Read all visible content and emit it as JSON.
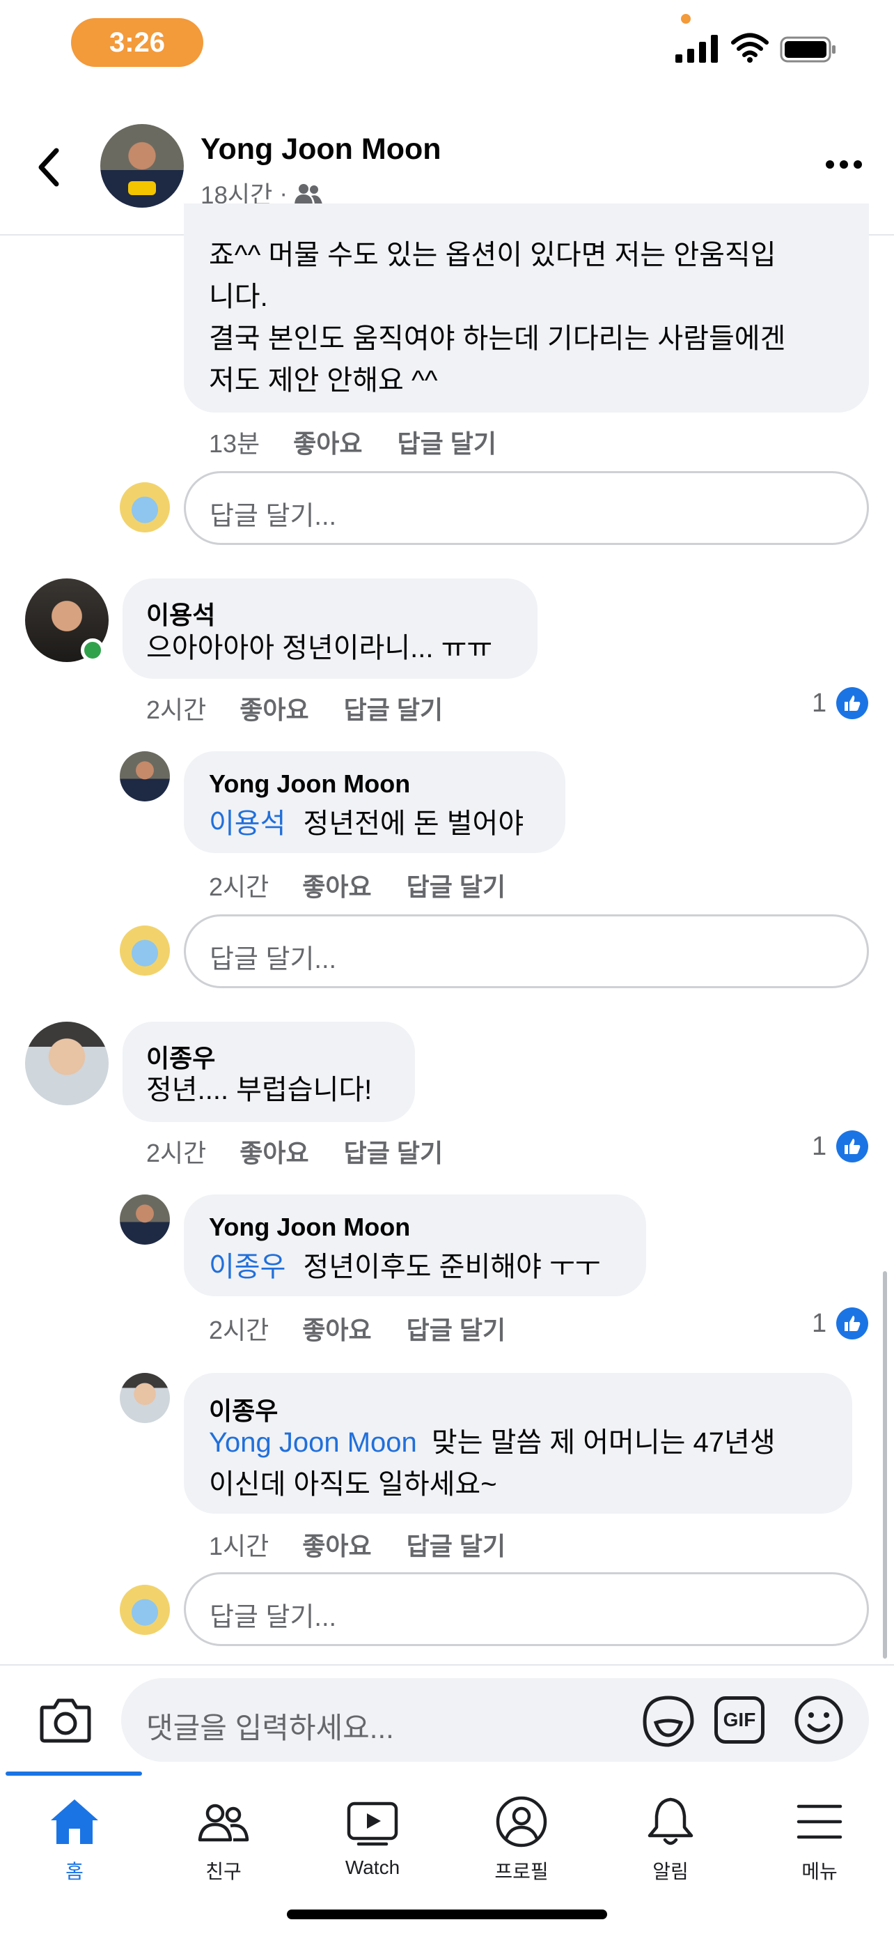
{
  "status": {
    "time": "3:26"
  },
  "header": {
    "name": "Yong Joon Moon",
    "time": "18시간"
  },
  "comments": {
    "top": {
      "lines": [
        "죠^^ 머물 수도 있는 옵션이 있다면 저는 안움직입",
        "니다.",
        "결국 본인도 움직여야 하는데 기다리는 사람들에겐",
        "저도 제안 안해요 ^^"
      ],
      "time": "13분",
      "like": "좋아요",
      "reply": "답글 달기"
    },
    "reply_placeholder": "답글 달기...",
    "c1": {
      "name": "이용석",
      "text": "으아아아아 정년이라니... ㅠㅠ",
      "time": "2시간",
      "like": "좋아요",
      "reply": "답글 달기",
      "likes": "1"
    },
    "r1": {
      "name": "Yong Joon Moon",
      "mention": "이용석",
      "text": "정년전에 돈 벌어야",
      "time": "2시간",
      "like": "좋아요",
      "reply": "답글 달기"
    },
    "c2": {
      "name": "이종우",
      "text": "정년.... 부럽습니다!",
      "time": "2시간",
      "like": "좋아요",
      "reply": "답글 달기",
      "likes": "1"
    },
    "r2": {
      "name": "Yong Joon Moon",
      "mention": "이종우",
      "text": "정년이후도 준비해야 ㅜㅜ",
      "time": "2시간",
      "like": "좋아요",
      "reply": "답글 달기",
      "likes": "1"
    },
    "r3": {
      "name": "이종우",
      "mention": "Yong Joon Moon",
      "text1": "맞는 말씀 제 어머니는 47년생",
      "text2": "이신데 아직도 일하세요~",
      "time": "1시간",
      "like": "좋아요",
      "reply": "답글 달기"
    }
  },
  "composer": {
    "placeholder": "댓글을 입력하세요...",
    "gif": "GIF"
  },
  "tabs": [
    {
      "label": "홈",
      "icon": "home-icon"
    },
    {
      "label": "친구",
      "icon": "friends-icon"
    },
    {
      "label": "Watch",
      "icon": "watch-icon"
    },
    {
      "label": "프로필",
      "icon": "profile-icon"
    },
    {
      "label": "알림",
      "icon": "bell-icon"
    },
    {
      "label": "메뉴",
      "icon": "menu-icon"
    }
  ],
  "colors": {
    "accent": "#1b74e4",
    "mention": "#216fdb",
    "bubble": "#f0f2f5",
    "time_pill": "#f39a3a"
  }
}
